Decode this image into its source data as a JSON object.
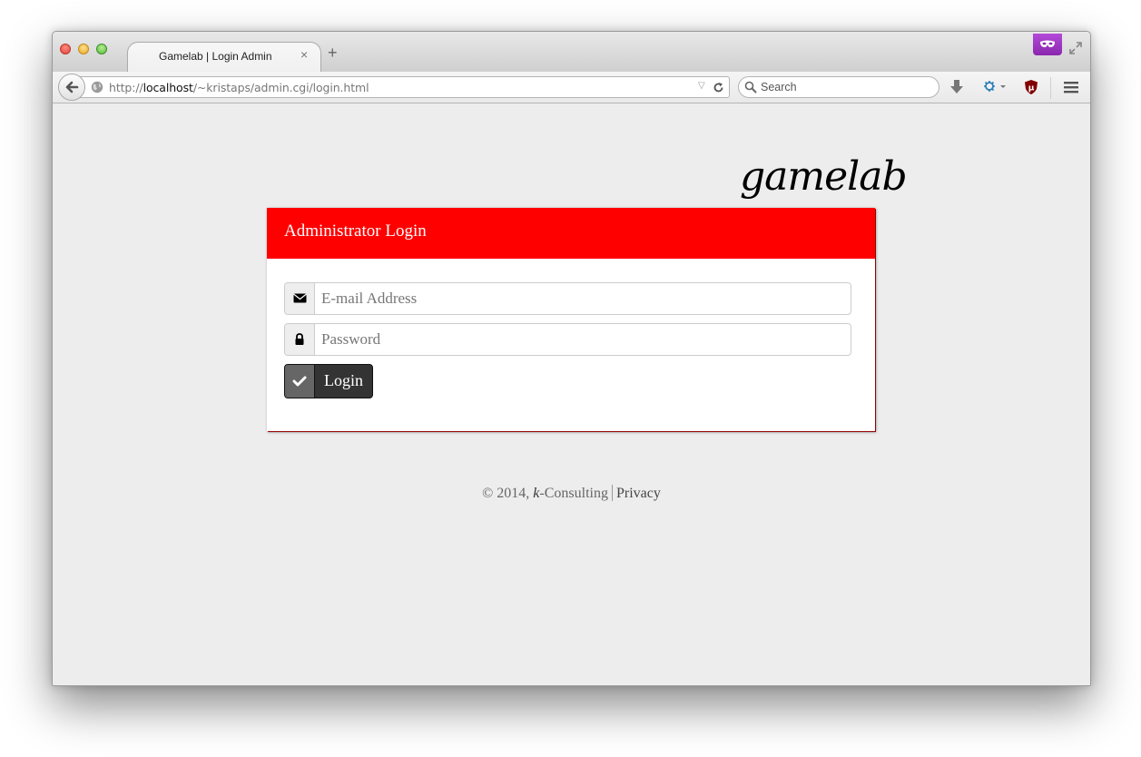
{
  "browser": {
    "tab": {
      "title": "Gamelab | Login Admin",
      "close_glyph": "×"
    },
    "new_tab_glyph": "+",
    "url": {
      "scheme": "http://",
      "host": "localhost",
      "path": "/~kristaps/admin.cgi/login.html"
    },
    "search": {
      "placeholder": "Search"
    },
    "icons": [
      "globe-icon",
      "reload-icon",
      "search-icon",
      "download-icon",
      "extension-icon",
      "ublock-icon",
      "hamburger-menu-icon",
      "private-mask-icon",
      "fullscreen-icon",
      "back-arrow-icon"
    ]
  },
  "page": {
    "logo_text": "gamelab",
    "login_panel": {
      "title": "Administrator Login",
      "email_placeholder": "E-mail Address",
      "password_placeholder": "Password",
      "login_label": "Login"
    },
    "footer": {
      "copyright": "© 2014, ",
      "company_italic": "k",
      "company_rest": "-Consulting",
      "privacy_label": "Privacy"
    }
  },
  "colors": {
    "header_red": "#ff0000",
    "page_background": "#ededed",
    "button_dark": "#333333",
    "private_purple": "#9b36c4"
  }
}
